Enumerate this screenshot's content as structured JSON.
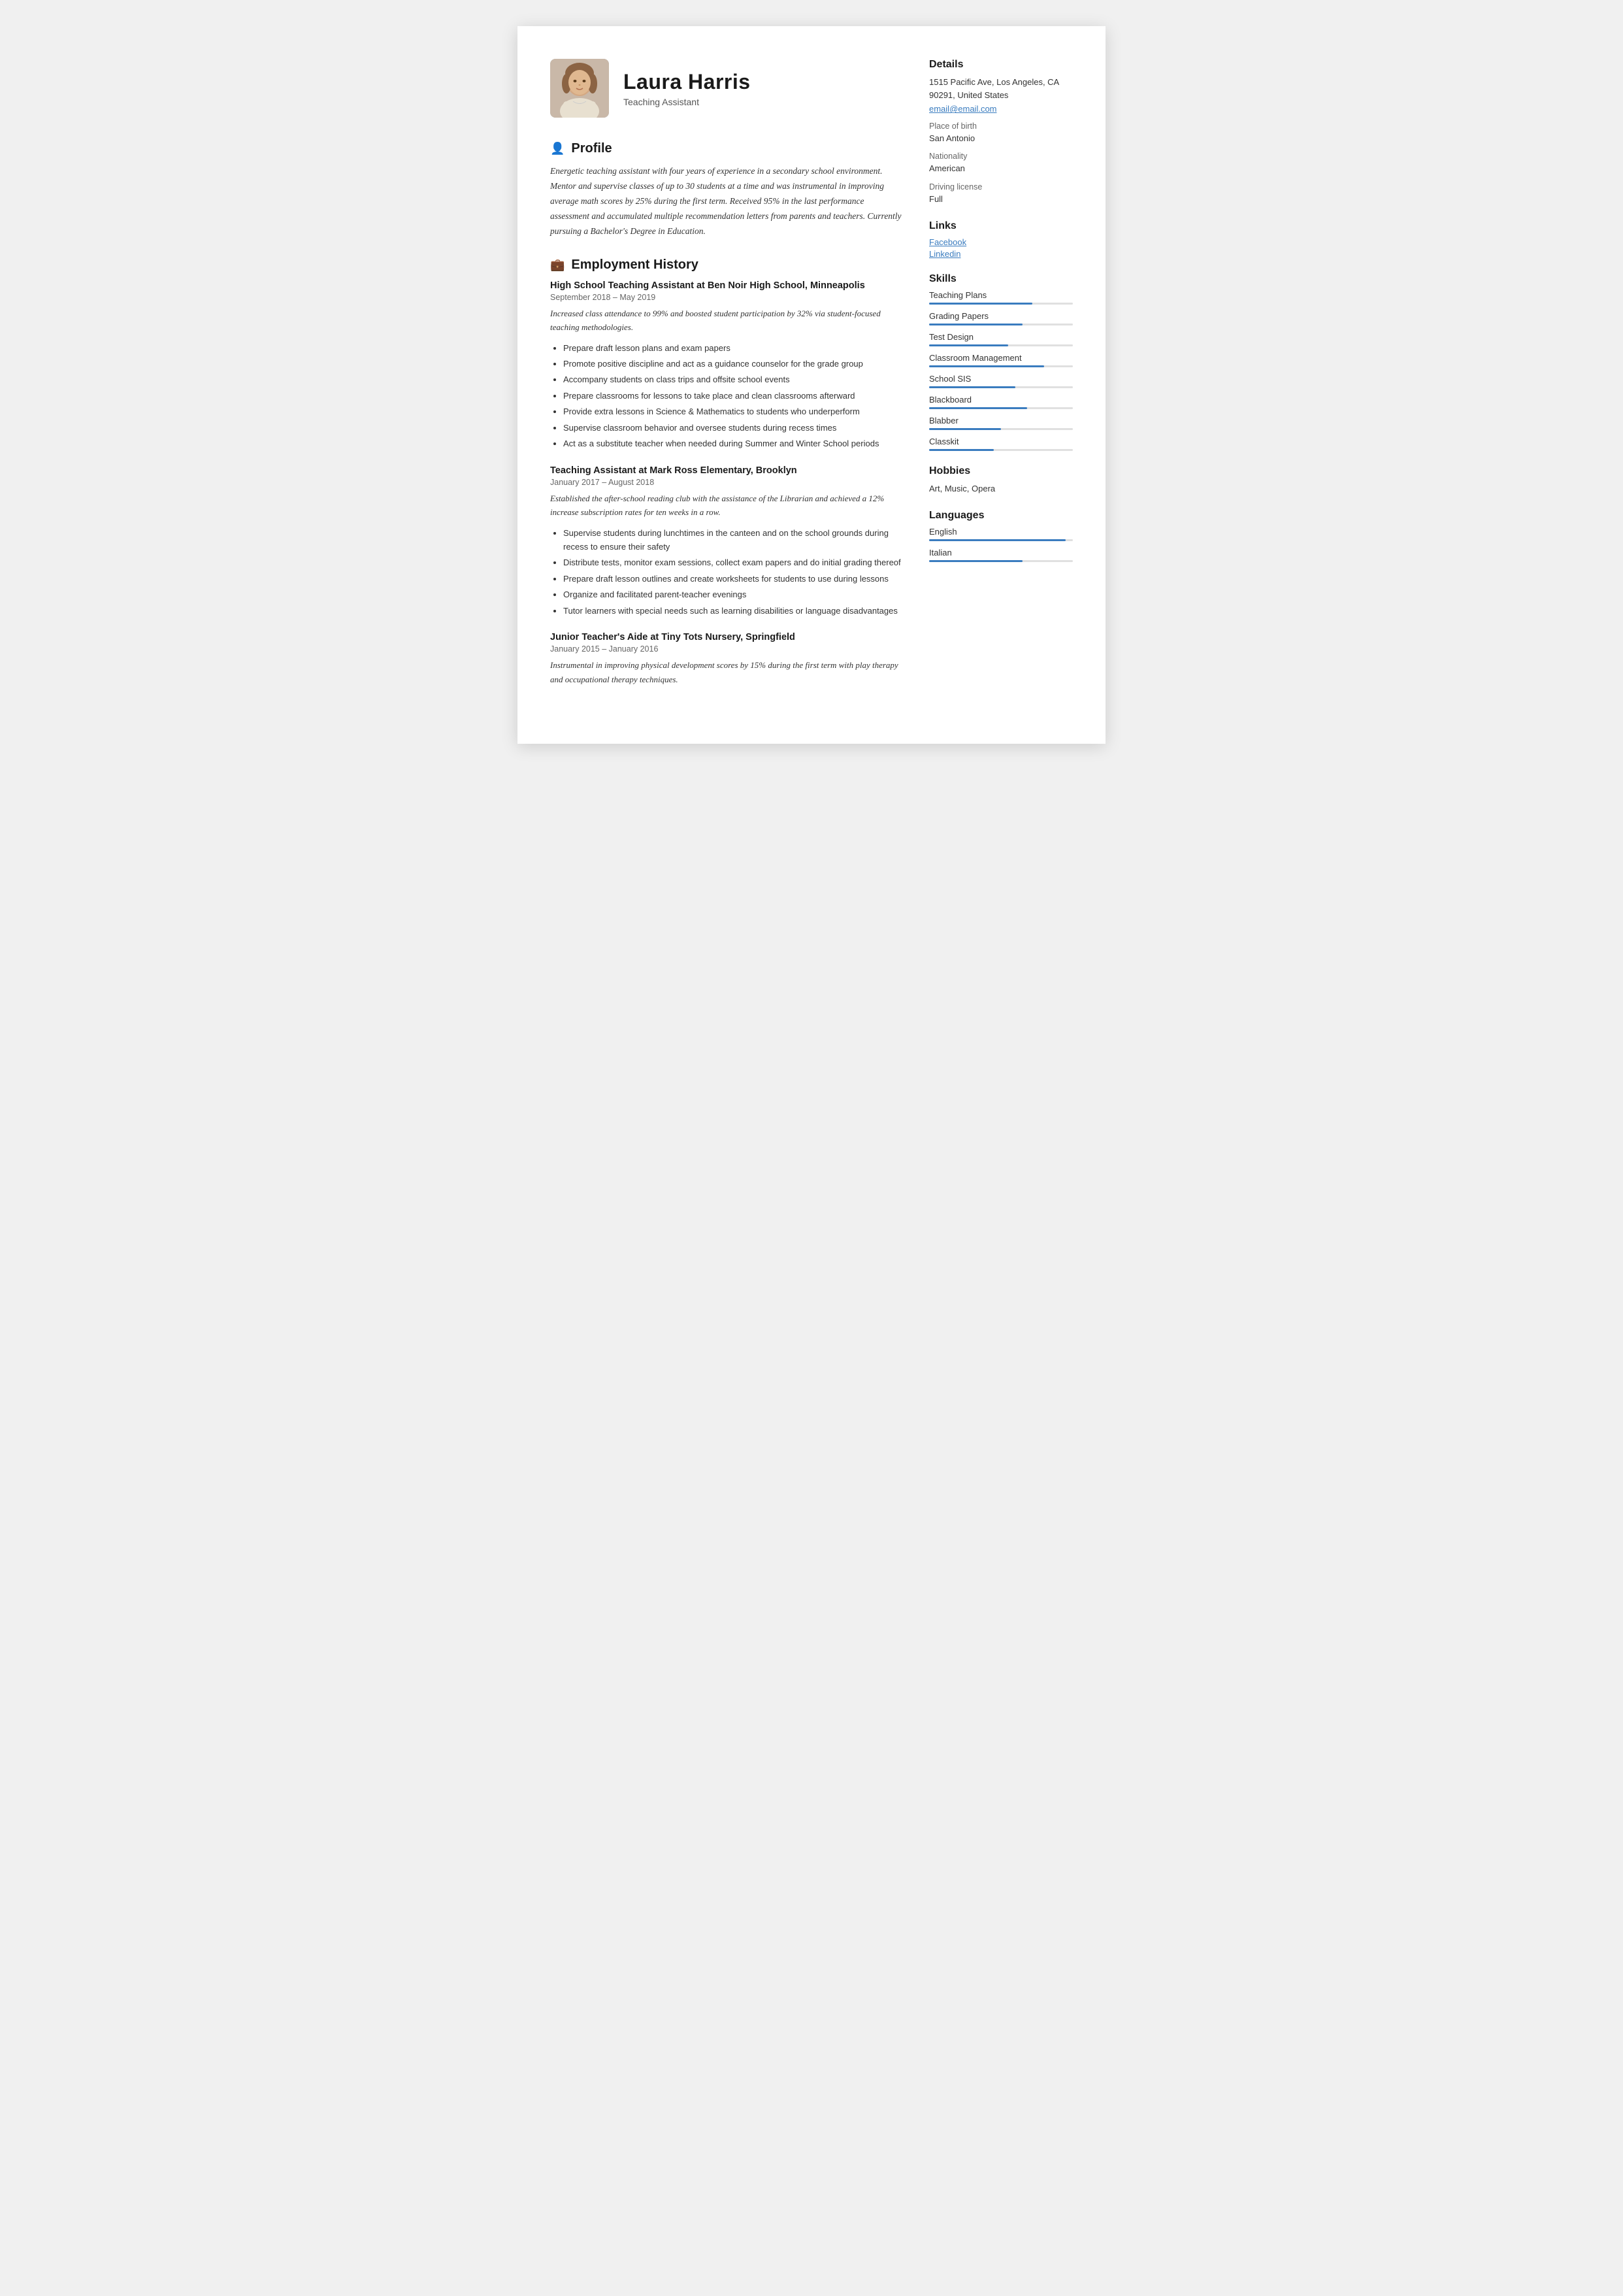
{
  "header": {
    "name": "Laura Harris",
    "job_title": "Teaching Assistant"
  },
  "profile": {
    "section_title": "Profile",
    "text": "Energetic teaching assistant with four years of experience in a secondary school environment. Mentor and supervise classes of up to 30 students at a time and was instrumental in improving average math scores by 25% during the first term. Received 95% in the last performance assessment and accumulated multiple recommendation letters from parents and teachers. Currently pursuing a Bachelor's Degree in Education."
  },
  "employment": {
    "section_title": "Employment History",
    "jobs": [
      {
        "title": "High School Teaching Assistant at Ben Noir High School, Minneapolis",
        "dates": "September 2018  –  May 2019",
        "description": "Increased class attendance to 99% and boosted student participation by 32% via student-focused teaching methodologies.",
        "bullets": [
          "Prepare draft lesson plans and exam papers",
          "Promote positive discipline and act as a guidance counselor for the grade group",
          "Accompany students on class trips and offsite school events",
          "Prepare classrooms for lessons to take place and clean classrooms afterward",
          "Provide extra lessons in Science & Mathematics to students who underperform",
          "Supervise classroom behavior and oversee students during recess times",
          "Act as a substitute teacher when needed during Summer and Winter School periods"
        ]
      },
      {
        "title": "Teaching Assistant at Mark Ross Elementary, Brooklyn",
        "dates": "January 2017  –  August 2018",
        "description": "Established the after-school reading club with the assistance of the Librarian and achieved a 12% increase subscription rates for ten weeks in a row.",
        "bullets": [
          "Supervise students during lunchtimes in the canteen and on the school grounds during recess to ensure their safety",
          "Distribute tests, monitor exam sessions, collect exam papers and do initial grading thereof",
          "Prepare draft lesson outlines and create worksheets for students to use during lessons",
          "Organize and facilitated parent-teacher evenings",
          "Tutor learners with special needs such as learning disabilities or language disadvantages"
        ]
      },
      {
        "title": "Junior Teacher's Aide at Tiny Tots Nursery, Springfield",
        "dates": "January 2015  –  January 2016",
        "description": "Instrumental in improving physical development scores by 15% during the first term with play therapy and occupational therapy techniques.",
        "bullets": []
      }
    ]
  },
  "details": {
    "section_title": "Details",
    "address": "1515 Pacific Ave, Los Angeles, CA 90291, United States",
    "email": "email@email.com",
    "place_of_birth_label": "Place of birth",
    "place_of_birth": "San Antonio",
    "nationality_label": "Nationality",
    "nationality": "American",
    "driving_license_label": "Driving license",
    "driving_license": "Full"
  },
  "links": {
    "section_title": "Links",
    "items": [
      {
        "label": "Facebook",
        "url": "#"
      },
      {
        "label": "Linkedin",
        "url": "#"
      }
    ]
  },
  "skills": {
    "section_title": "Skills",
    "items": [
      {
        "name": "Teaching Plans",
        "level": 72
      },
      {
        "name": "Grading Papers",
        "level": 65
      },
      {
        "name": "Test Design",
        "level": 55
      },
      {
        "name": "Classroom Management",
        "level": 80
      },
      {
        "name": "School SIS",
        "level": 60
      },
      {
        "name": "Blackboard",
        "level": 68
      },
      {
        "name": "Blabber",
        "level": 50
      },
      {
        "name": "Classkit",
        "level": 45
      }
    ]
  },
  "hobbies": {
    "section_title": "Hobbies",
    "text": "Art, Music, Opera"
  },
  "languages": {
    "section_title": "Languages",
    "items": [
      {
        "name": "English",
        "level": 95
      },
      {
        "name": "Italian",
        "level": 65
      }
    ]
  }
}
